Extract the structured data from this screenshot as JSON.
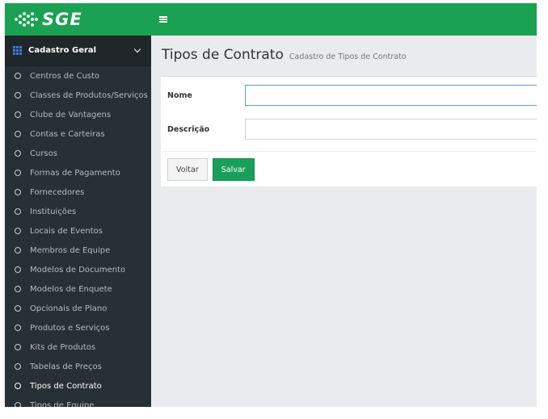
{
  "topbar": {
    "logo_text": "SGE",
    "brand_color": "#1aa152",
    "icons": {
      "logo": "dots-globe-icon",
      "menu": "hamburger-icon"
    }
  },
  "sidebar": {
    "section_label": "Cadastro Geral",
    "section_icon": "grid-icon",
    "items": [
      {
        "label": "Centros de Custo"
      },
      {
        "label": "Classes de Produtos/Serviços"
      },
      {
        "label": "Clube de Vantagens"
      },
      {
        "label": "Contas e Carteiras"
      },
      {
        "label": "Cursos"
      },
      {
        "label": "Formas de Pagamento"
      },
      {
        "label": "Fornecedores"
      },
      {
        "label": "Instituições"
      },
      {
        "label": "Locais de Eventos"
      },
      {
        "label": "Membros de Equipe"
      },
      {
        "label": "Modelos de Documento"
      },
      {
        "label": "Modelos de Enquete"
      },
      {
        "label": "Opcionais de Plano"
      },
      {
        "label": "Produtos e Serviços"
      },
      {
        "label": "Kits de Produtos"
      },
      {
        "label": "Tabelas de Preços"
      },
      {
        "label": "Tipos de Contrato",
        "active": true
      },
      {
        "label": "Tipos de Equipe"
      }
    ]
  },
  "main": {
    "title": "Tipos de Contrato",
    "subtitle": "Cadastro de Tipos de Contrato",
    "form": {
      "nome_label": "Nome",
      "nome_value": "",
      "descricao_label": "Descrição",
      "descricao_value": ""
    },
    "buttons": {
      "back_label": "Voltar",
      "save_label": "Salvar",
      "save_color": "#18a05a"
    }
  }
}
